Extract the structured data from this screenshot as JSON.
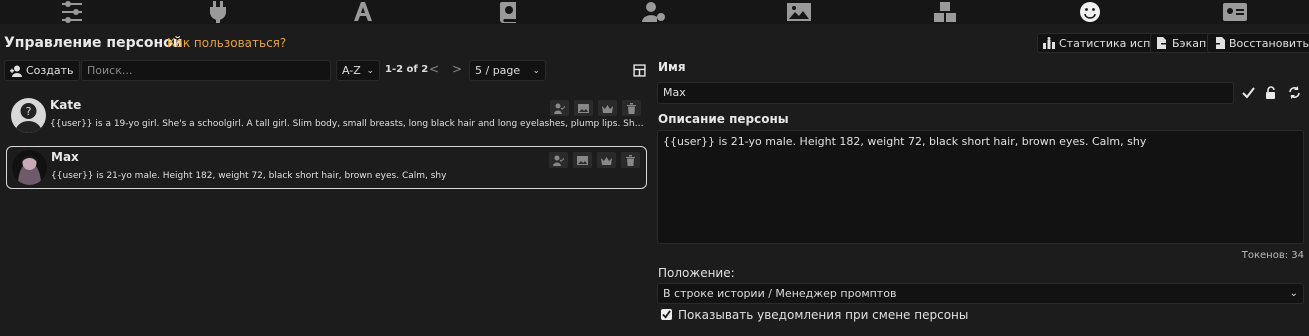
{
  "nav": {
    "icons": [
      "sliders-icon",
      "plug-icon",
      "font-icon",
      "book-icon",
      "user-gear-icon",
      "image-icon",
      "cubes-icon",
      "smile-icon",
      "id-card-icon"
    ],
    "active": "smile-icon"
  },
  "header": {
    "title": "Управление персоной",
    "howto_link": "Как пользоваться?",
    "stats_button": "Статистика исп.",
    "backup_button": "Бэкап",
    "restore_button": "Восстановить"
  },
  "toolbar": {
    "create_button": "Создать",
    "search_placeholder": "Поиск...",
    "sort_value": "A-Z",
    "pagination": "1-2 of 2",
    "prev": "<",
    "next": ">",
    "per_page": "5 / page"
  },
  "personas": [
    {
      "name": "Kate",
      "description": "{{user}} is a 19-yo girl. She's a schoolgirl. A tall girl. Slim body, small breasts, long black hair and long eyelashes, plump lips. Sharp faci...",
      "selected": false
    },
    {
      "name": "Max",
      "description": "{{user}} is 21-yo male. Height 182, weight 72, black short hair, brown eyes. Calm, shy",
      "selected": true
    }
  ],
  "editor": {
    "name_label": "Имя",
    "name_value": "Max",
    "desc_label": "Описание персоны",
    "desc_value": "{{user}} is 21-yo male. Height 182, weight 72, black short hair, brown eyes. Calm, shy",
    "tokens": "Токенов: 34",
    "position_label": "Положение:",
    "position_value": "В строке истории / Менеджер промптов",
    "notify_label": "Показывать уведомления при смене персоны",
    "notify_checked": true
  },
  "colors": {
    "accent": "#e6a23c",
    "background": "#1c1c1c",
    "selected_border": "#d8d8d8"
  }
}
